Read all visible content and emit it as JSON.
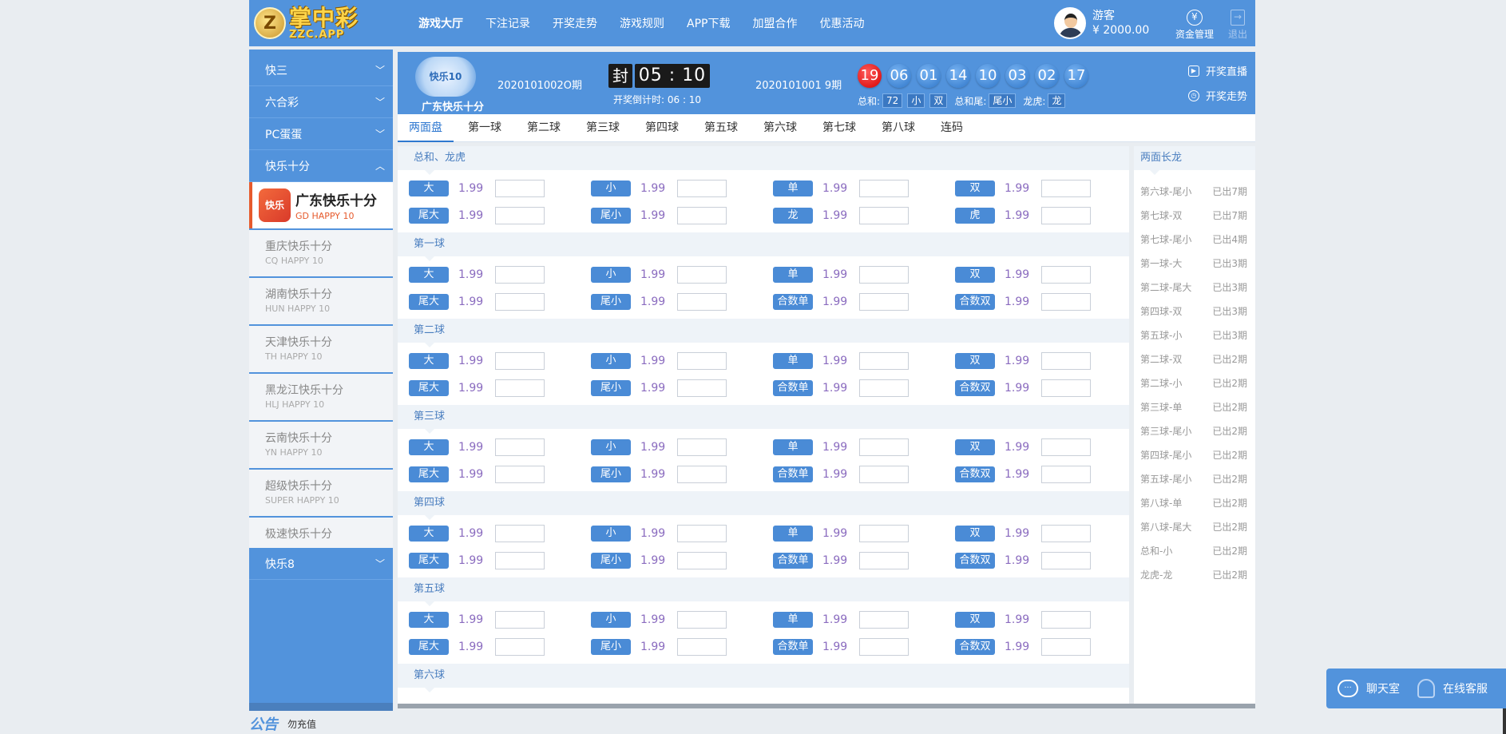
{
  "header": {
    "logo_main": "掌中彩",
    "logo_sub": "ZZC.APP",
    "nav": [
      "游戏大厅",
      "下注记录",
      "开奖走势",
      "游戏规则",
      "APP下载",
      "加盟合作",
      "优惠活动"
    ],
    "user_name": "游客",
    "user_balance": "¥ 2000.00",
    "funds_label": "资金管理",
    "logout_label": "退出"
  },
  "sidebar": {
    "categories": [
      {
        "label": "快三",
        "chevron": "chevron-down-icon"
      },
      {
        "label": "六合彩",
        "chevron": "chevron-down-icon"
      },
      {
        "label": "PC蛋蛋",
        "chevron": "chevron-down-icon"
      },
      {
        "label": "快乐十分",
        "chevron": "chevron-up-icon"
      }
    ],
    "active_game": {
      "cn": "广东快乐十分",
      "en": "GD HAPPY 10"
    },
    "games": [
      {
        "cn": "重庆快乐十分",
        "en": "CQ HAPPY 10"
      },
      {
        "cn": "湖南快乐十分",
        "en": "HUN HAPPY 10"
      },
      {
        "cn": "天津快乐十分",
        "en": "TH HAPPY 10"
      },
      {
        "cn": "黑龙江快乐十分",
        "en": "HLJ HAPPY 10"
      },
      {
        "cn": "云南快乐十分",
        "en": "YN HAPPY 10"
      },
      {
        "cn": "超级快乐十分",
        "en": "SUPER HAPPY 10"
      },
      {
        "cn": "极速快乐十分",
        "en": ""
      }
    ],
    "bottom_category": {
      "label": "快乐8",
      "chevron": "chevron-down-icon"
    }
  },
  "lottery": {
    "name": "广东快乐十分",
    "current_issue": "2020101002О期",
    "seal_label": "封",
    "countdown": "05 : 10",
    "countdown_label": "开奖倒计时: 06 : 10",
    "prev_issue": "2020101001 9期",
    "balls": [
      "19",
      "06",
      "01",
      "14",
      "10",
      "03",
      "02",
      "17"
    ],
    "stats": {
      "sum_label": "总和:",
      "sum_value": "72",
      "sum_size": "小",
      "sum_parity": "双",
      "tail_label": "总和尾:",
      "tail_value": "尾小",
      "dragon_label": "龙虎:",
      "dragon_value": "龙"
    },
    "links": {
      "live": "开奖直播",
      "trend": "开奖走势"
    }
  },
  "tabs": [
    "两面盘",
    "第一球",
    "第二球",
    "第三球",
    "第四球",
    "第五球",
    "第六球",
    "第七球",
    "第八球",
    "连码"
  ],
  "sections": [
    {
      "title": "总和、龙虎",
      "rows": [
        [
          {
            "label": "大",
            "odds": "1.99"
          },
          {
            "label": "小",
            "odds": "1.99"
          },
          {
            "label": "单",
            "odds": "1.99"
          },
          {
            "label": "双",
            "odds": "1.99"
          }
        ],
        [
          {
            "label": "尾大",
            "odds": "1.99"
          },
          {
            "label": "尾小",
            "odds": "1.99"
          },
          {
            "label": "龙",
            "odds": "1.99"
          },
          {
            "label": "虎",
            "odds": "1.99"
          }
        ]
      ]
    },
    {
      "title": "第一球",
      "rows": [
        [
          {
            "label": "大",
            "odds": "1.99"
          },
          {
            "label": "小",
            "odds": "1.99"
          },
          {
            "label": "单",
            "odds": "1.99"
          },
          {
            "label": "双",
            "odds": "1.99"
          }
        ],
        [
          {
            "label": "尾大",
            "odds": "1.99"
          },
          {
            "label": "尾小",
            "odds": "1.99"
          },
          {
            "label": "合数单",
            "odds": "1.99"
          },
          {
            "label": "合数双",
            "odds": "1.99"
          }
        ]
      ]
    },
    {
      "title": "第二球",
      "rows": [
        [
          {
            "label": "大",
            "odds": "1.99"
          },
          {
            "label": "小",
            "odds": "1.99"
          },
          {
            "label": "单",
            "odds": "1.99"
          },
          {
            "label": "双",
            "odds": "1.99"
          }
        ],
        [
          {
            "label": "尾大",
            "odds": "1.99"
          },
          {
            "label": "尾小",
            "odds": "1.99"
          },
          {
            "label": "合数单",
            "odds": "1.99"
          },
          {
            "label": "合数双",
            "odds": "1.99"
          }
        ]
      ]
    },
    {
      "title": "第三球",
      "rows": [
        [
          {
            "label": "大",
            "odds": "1.99"
          },
          {
            "label": "小",
            "odds": "1.99"
          },
          {
            "label": "单",
            "odds": "1.99"
          },
          {
            "label": "双",
            "odds": "1.99"
          }
        ],
        [
          {
            "label": "尾大",
            "odds": "1.99"
          },
          {
            "label": "尾小",
            "odds": "1.99"
          },
          {
            "label": "合数单",
            "odds": "1.99"
          },
          {
            "label": "合数双",
            "odds": "1.99"
          }
        ]
      ]
    },
    {
      "title": "第四球",
      "rows": [
        [
          {
            "label": "大",
            "odds": "1.99"
          },
          {
            "label": "小",
            "odds": "1.99"
          },
          {
            "label": "单",
            "odds": "1.99"
          },
          {
            "label": "双",
            "odds": "1.99"
          }
        ],
        [
          {
            "label": "尾大",
            "odds": "1.99"
          },
          {
            "label": "尾小",
            "odds": "1.99"
          },
          {
            "label": "合数单",
            "odds": "1.99"
          },
          {
            "label": "合数双",
            "odds": "1.99"
          }
        ]
      ]
    },
    {
      "title": "第五球",
      "rows": [
        [
          {
            "label": "大",
            "odds": "1.99"
          },
          {
            "label": "小",
            "odds": "1.99"
          },
          {
            "label": "单",
            "odds": "1.99"
          },
          {
            "label": "双",
            "odds": "1.99"
          }
        ],
        [
          {
            "label": "尾大",
            "odds": "1.99"
          },
          {
            "label": "尾小",
            "odds": "1.99"
          },
          {
            "label": "合数单",
            "odds": "1.99"
          },
          {
            "label": "合数双",
            "odds": "1.99"
          }
        ]
      ]
    },
    {
      "title": "第六球",
      "rows": []
    }
  ],
  "long_dragon": {
    "title": "两面长龙",
    "items": [
      {
        "name": "第六球-尾小",
        "count": "已出7期"
      },
      {
        "name": "第七球-双",
        "count": "已出7期"
      },
      {
        "name": "第七球-尾小",
        "count": "已出4期"
      },
      {
        "name": "第一球-大",
        "count": "已出3期"
      },
      {
        "name": "第二球-尾大",
        "count": "已出3期"
      },
      {
        "name": "第四球-双",
        "count": "已出3期"
      },
      {
        "name": "第五球-小",
        "count": "已出3期"
      },
      {
        "name": "第二球-双",
        "count": "已出2期"
      },
      {
        "name": "第二球-小",
        "count": "已出2期"
      },
      {
        "name": "第三球-单",
        "count": "已出2期"
      },
      {
        "name": "第三球-尾小",
        "count": "已出2期"
      },
      {
        "name": "第四球-尾小",
        "count": "已出2期"
      },
      {
        "name": "第五球-尾小",
        "count": "已出2期"
      },
      {
        "name": "第八球-单",
        "count": "已出2期"
      },
      {
        "name": "第八球-尾大",
        "count": "已出2期"
      },
      {
        "name": "总和-小",
        "count": "已出2期"
      },
      {
        "name": "龙虎-龙",
        "count": "已出2期"
      }
    ]
  },
  "notice": {
    "title": "公告",
    "text": "勿充值"
  },
  "chat": {
    "room": "聊天室",
    "service": "在线客服"
  },
  "colors": {
    "brand_blue": "#5293dc",
    "ball_red": "#d60000",
    "odds_purple": "#8a6bbf"
  }
}
